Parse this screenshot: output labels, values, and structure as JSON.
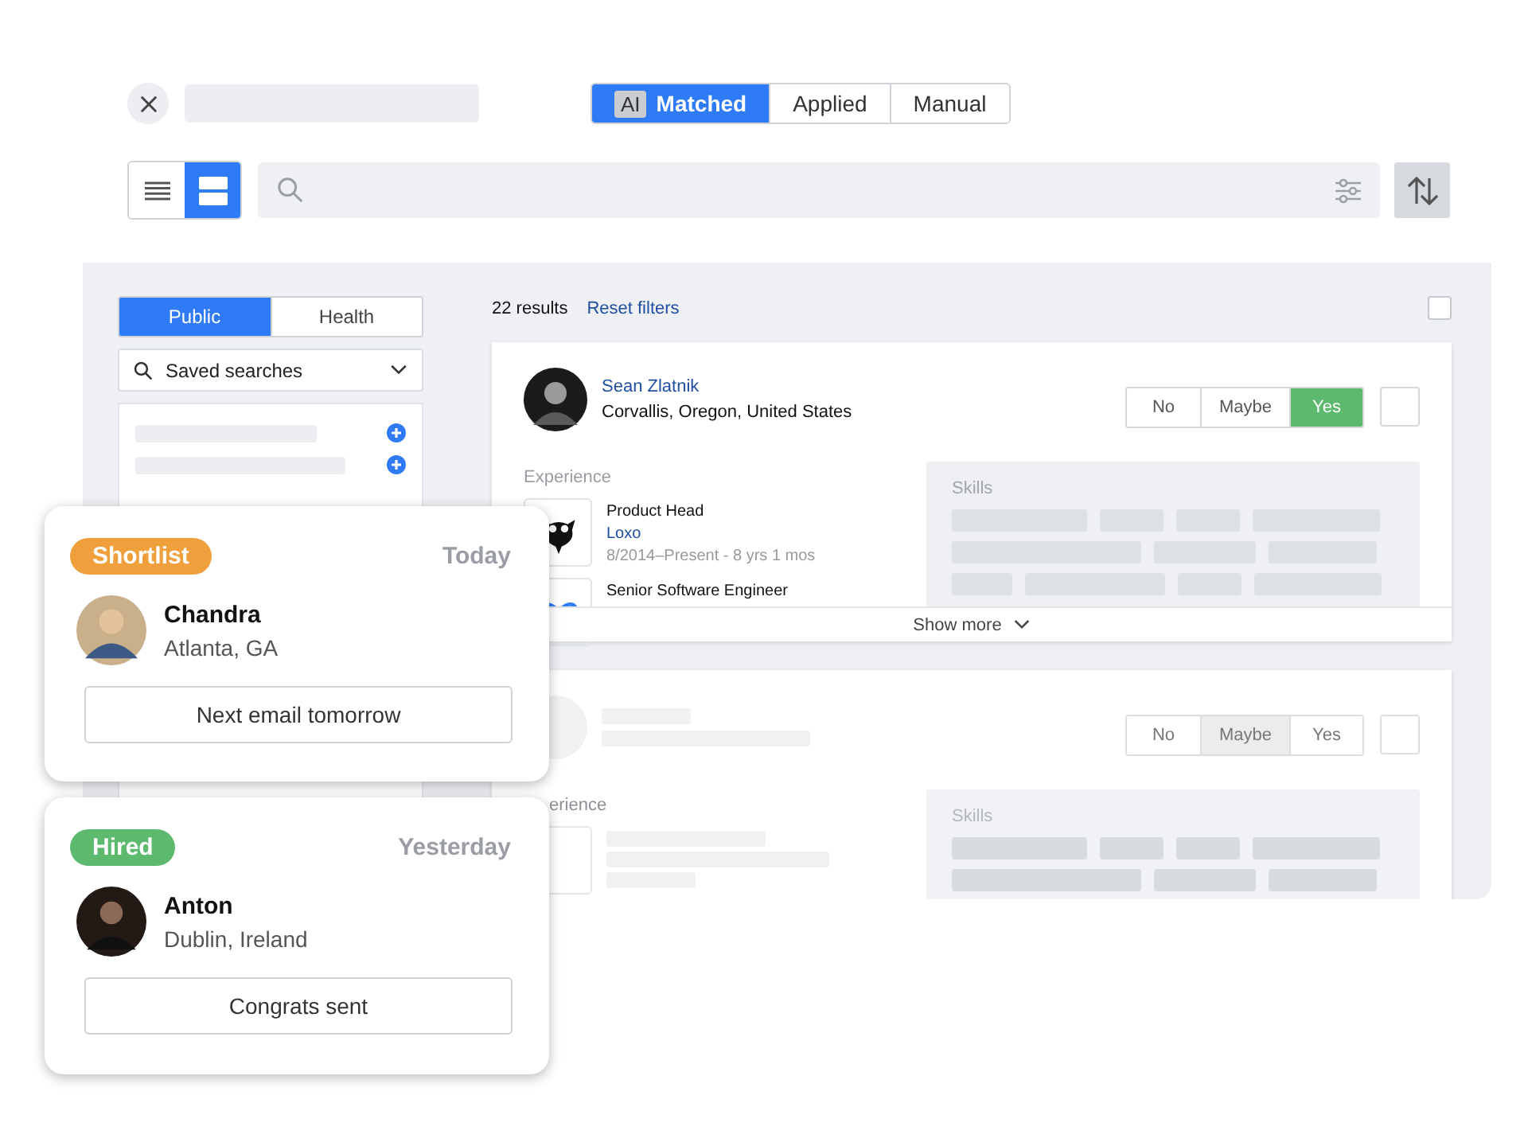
{
  "header": {
    "tabs": [
      {
        "label": "Matched",
        "badge": "AI",
        "selected": true
      },
      {
        "label": "Applied",
        "selected": false
      },
      {
        "label": "Manual",
        "selected": false
      }
    ],
    "view_modes": [
      {
        "kind": "list",
        "selected": false
      },
      {
        "kind": "cards",
        "selected": true
      }
    ]
  },
  "sidebar": {
    "tabs": [
      {
        "label": "Public",
        "selected": true
      },
      {
        "label": "Health",
        "selected": false
      }
    ],
    "saved_searches": "Saved searches"
  },
  "results": {
    "count": "22 results",
    "reset": "Reset filters",
    "select_all_checked": false
  },
  "candidates": [
    {
      "faded": false,
      "name": "Sean Zlatnik",
      "location": "Corvallis, Oregon, United States",
      "checked": false,
      "decisions": [
        {
          "label": "No",
          "selected": false
        },
        {
          "label": "Maybe",
          "selected": false
        },
        {
          "label": "Yes",
          "selected": true
        }
      ],
      "experience_label": "Experience",
      "experience": [
        {
          "kind": "bird",
          "title": "Product Head",
          "company": "Loxo",
          "dates": "8/2014–Present - 8 yrs 1 mos"
        },
        {
          "kind": "loop",
          "title": "Senior Software Engineer"
        }
      ],
      "skills_label": "Skills",
      "show_more": "Show more"
    },
    {
      "faded": true,
      "checked": false,
      "decisions": [
        {
          "label": "No",
          "selected": false
        },
        {
          "label": "Maybe",
          "selected": true
        },
        {
          "label": "Yes",
          "selected": false
        }
      ],
      "experience_label": "erience",
      "skills_label": "Skills"
    }
  ],
  "status_cards": [
    {
      "status": "Shortlist",
      "color": "#ef9f3c",
      "when": "Today",
      "name": "Chandra",
      "location": "Atlanta, GA",
      "action": "Next email tomorrow"
    },
    {
      "status": "Hired",
      "color": "#5cb96d",
      "when": "Yesterday",
      "name": "Anton",
      "location": "Dublin, Ireland",
      "action": "Congrats sent"
    }
  ]
}
